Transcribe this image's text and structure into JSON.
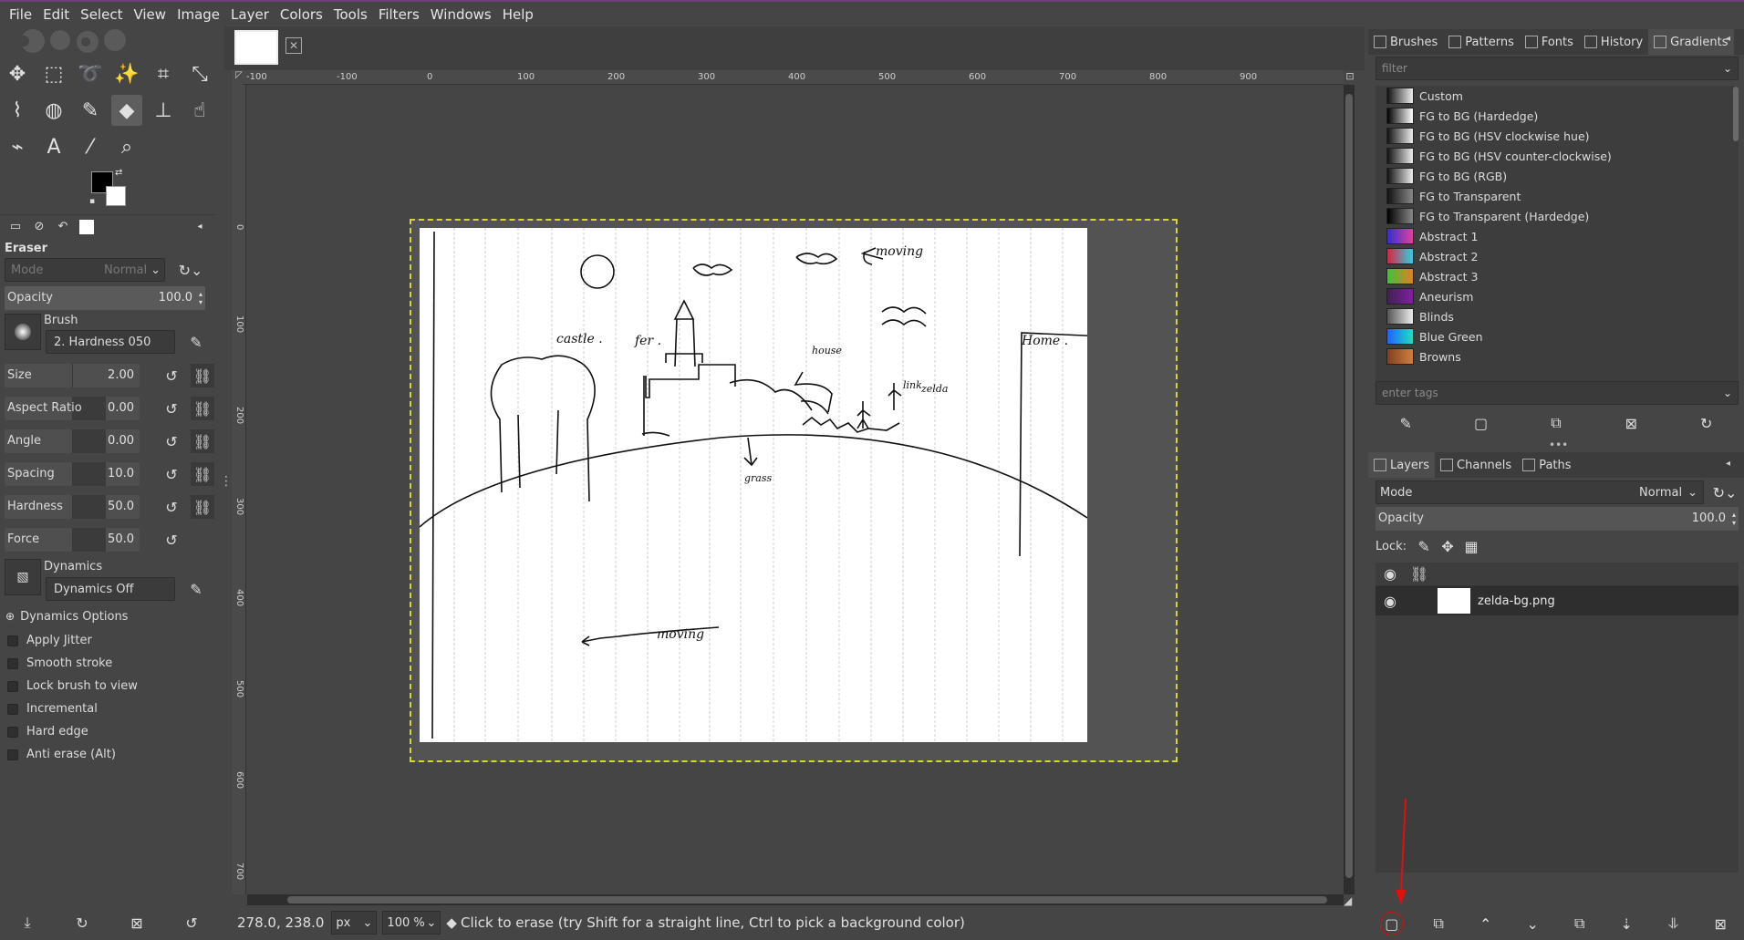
{
  "menu": [
    "File",
    "Edit",
    "Select",
    "View",
    "Image",
    "Layer",
    "Colors",
    "Tools",
    "Filters",
    "Windows",
    "Help"
  ],
  "tool_icons": [
    "move-icon",
    "rect-select-icon",
    "lasso-icon",
    "fuzzy-select-icon",
    "crop-icon",
    "transform-icon",
    "warp-icon",
    "bucket-fill-icon",
    "paintbrush-icon",
    "eraser-icon",
    "clone-icon",
    "smudge-icon",
    "paths-icon",
    "text-icon",
    "color-picker-icon",
    "zoom-icon"
  ],
  "tool_options": {
    "title": "Eraser",
    "mode_label": "Mode",
    "mode_value": "Normal",
    "opacity_label": "Opacity",
    "opacity_value": "100.0",
    "opacity": 1.0,
    "brush_label": "Brush",
    "brush_value": "2. Hardness 050",
    "sliders": [
      {
        "label": "Size",
        "value": "2.00",
        "level": 0.02
      },
      {
        "label": "Aspect Ratio",
        "value": "0.00",
        "level": 0.5
      },
      {
        "label": "Angle",
        "value": "0.00",
        "level": 0.5
      },
      {
        "label": "Spacing",
        "value": "10.0",
        "level": 0.5
      },
      {
        "label": "Hardness",
        "value": "50.0",
        "level": 0.5
      },
      {
        "label": "Force",
        "value": "50.0",
        "level": 0.5
      }
    ],
    "dynamics_label": "Dynamics",
    "dynamics_value": "Dynamics Off",
    "dynamics_options": "Dynamics Options",
    "checkboxes": [
      "Apply Jitter",
      "Smooth stroke",
      "Lock brush to view",
      "Incremental",
      "Hard edge",
      "Anti erase  (Alt)"
    ]
  },
  "ruler": {
    "h_ticks": [
      "-100",
      "-100",
      "0",
      "100",
      "200",
      "300",
      "400",
      "500",
      "600",
      "700",
      "800",
      "900"
    ],
    "v_ticks": [
      "0",
      "100",
      "200",
      "300",
      "400",
      "500",
      "600",
      "700"
    ]
  },
  "status": {
    "coords": "278.0, 238.0",
    "unit": "px",
    "zoom": "100 %",
    "message": "Click to erase (try Shift for a straight line, Ctrl to pick a background color)"
  },
  "sketch_labels": [
    "castle .",
    "fer .",
    "Home .",
    "house",
    "link",
    "zelda",
    "moving",
    "moving",
    "grass"
  ],
  "dock": {
    "tabs": [
      "Brushes",
      "Patterns",
      "Fonts",
      "History",
      "Gradients"
    ],
    "filter_placeholder": "filter",
    "tags_placeholder": "enter tags",
    "gradients": [
      {
        "name": "Custom",
        "c1": "#111111",
        "c2": "#eeeeee"
      },
      {
        "name": "FG to BG (Hardedge)",
        "c1": "#000000",
        "c2": "#ffffff"
      },
      {
        "name": "FG to BG (HSV clockwise hue)",
        "c1": "#111111",
        "c2": "#eeeeee"
      },
      {
        "name": "FG to BG (HSV counter-clockwise)",
        "c1": "#111111",
        "c2": "#eeeeee"
      },
      {
        "name": "FG to BG (RGB)",
        "c1": "#111111",
        "c2": "#eeeeee"
      },
      {
        "name": "FG to Transparent",
        "c1": "#111111",
        "c2": "#888888"
      },
      {
        "name": "FG to Transparent (Hardedge)",
        "c1": "#000000",
        "c2": "#888888"
      },
      {
        "name": "Abstract 1",
        "c1": "#3030d0",
        "c2": "#e040a0"
      },
      {
        "name": "Abstract 2",
        "c1": "#e02040",
        "c2": "#30d0e0"
      },
      {
        "name": "Abstract 3",
        "c1": "#40c040",
        "c2": "#e08020"
      },
      {
        "name": "Aneurism",
        "c1": "#402050",
        "c2": "#8020a0"
      },
      {
        "name": "Blinds",
        "c1": "#555555",
        "c2": "#eeeeee"
      },
      {
        "name": "Blue Green",
        "c1": "#2060ff",
        "c2": "#20e0c0"
      },
      {
        "name": "Browns",
        "c1": "#804020",
        "c2": "#d08040"
      }
    ]
  },
  "layers": {
    "tabs": [
      "Layers",
      "Channels",
      "Paths"
    ],
    "mode_label": "Mode",
    "mode_value": "Normal",
    "opacity_label": "Opacity",
    "opacity_value": "100.0",
    "lock_label": "Lock:",
    "items": [
      {
        "name": "zelda-bg.png"
      }
    ]
  }
}
